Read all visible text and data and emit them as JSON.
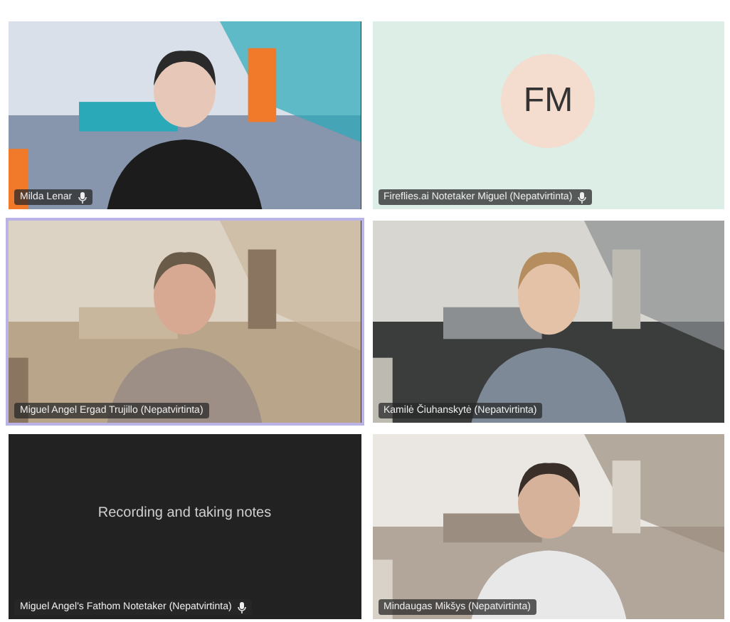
{
  "rows": [
    {
      "tiles": [
        {
          "kind": "video",
          "name": "Milda Lenar",
          "mic": true,
          "speaking": false
        },
        {
          "kind": "avatar",
          "name": "Fireflies.ai Notetaker Miguel (Nepatvirtinta)",
          "initials": "FM",
          "mic": true,
          "speaking": false
        }
      ]
    },
    {
      "tiles": [
        {
          "kind": "video",
          "name": "Miguel Angel Ergad Trujillo (Nepatvirtinta)",
          "mic": false,
          "speaking": true
        },
        {
          "kind": "video",
          "name": "Kamilė Čiuhanskytė (Nepatvirtinta)",
          "mic": false,
          "speaking": false
        }
      ]
    },
    {
      "tiles": [
        {
          "kind": "notice",
          "name": "Miguel Angel's Fathom Notetaker (Nepatvirtinta)",
          "message": "Recording and taking notes",
          "mic": true,
          "speaking": false
        },
        {
          "kind": "video",
          "name": "Mindaugas Mikšys (Nepatvirtinta)",
          "mic": false,
          "speaking": false
        }
      ]
    }
  ]
}
